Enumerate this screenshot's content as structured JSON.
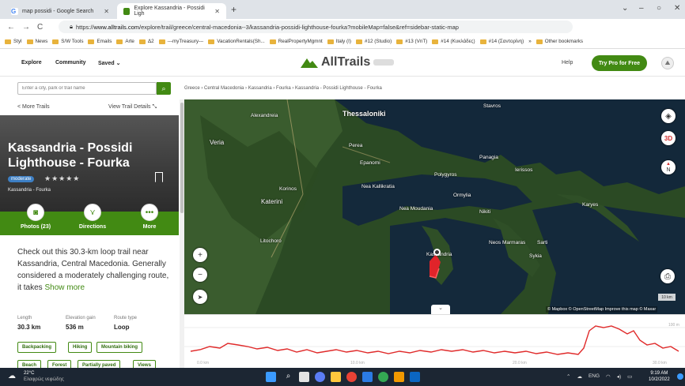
{
  "browser": {
    "tabs": [
      {
        "label": "map possidi - Google Search",
        "favicon_color": "#4285f4"
      },
      {
        "label": "Explore Kassandria - Possidi Ligh",
        "favicon_color": "#428a13"
      }
    ],
    "url_host": "www.alltrails.com",
    "url_path": "/explore/trail/greece/central-macedonia--3/kassandria-possidi-lighthouse-fourka?mobileMap=false&ref=sidebar-static-map",
    "url_prefix": "https://",
    "bookmarks": [
      "Styl",
      "News",
      "S/W Tools",
      "Emails",
      "Arte",
      "Δ2",
      "---myTreasury---",
      "VacationRentals(Sh...",
      "RealPropertyMgmnt",
      "Italy (I)",
      "#12 (Studio)",
      "#13 (VnT)",
      "#14 (Κυκλάδες)",
      "#14 (Σαντορίνη)",
      "»",
      "Other bookmarks"
    ]
  },
  "nav": {
    "explore": "Explore",
    "community": "Community",
    "saved": "Saved ⌄",
    "logo": "AllTrails",
    "help": "Help",
    "try_pro": "Try Pro for Free"
  },
  "search": {
    "placeholder": "Enter a city, park or trail name"
  },
  "breadcrumb": "Greece › Central Macedonia › Kassandria › Fourka › Kassandria - Possidi Lighthouse - Fourka",
  "sidebar": {
    "more_trails": "< More Trails",
    "view_details": "View Trail Details",
    "title": "Kassandria - Possidi Lighthouse - Fourka",
    "difficulty": "moderate",
    "stars": "★★★★★",
    "location": "Kassandria - Fourka",
    "actions": [
      {
        "label": "Photos (23)",
        "icon": "camera-icon",
        "glyph": "◙"
      },
      {
        "label": "Directions",
        "icon": "directions-icon",
        "glyph": "⋎"
      },
      {
        "label": "More",
        "icon": "more-icon",
        "glyph": "•••"
      }
    ],
    "description": "Check out this 30.3-km loop trail near Kassandria, Central Macedonia. Generally considered a moderately challenging route, it takes",
    "show_more": "Show more",
    "stats": [
      {
        "label": "Length",
        "value": "30.3 km"
      },
      {
        "label": "Elevation gain",
        "value": "536 m"
      },
      {
        "label": "Route type",
        "value": "Loop"
      }
    ],
    "tags": [
      "Backpacking",
      "Hiking",
      "Mountain biking",
      "Beach",
      "Forest",
      "Partially paved",
      "Views"
    ]
  },
  "map": {
    "labels": [
      {
        "text": "Thessaloniki",
        "big": true
      },
      {
        "text": "Veria"
      },
      {
        "text": "Alexandreia"
      },
      {
        "text": "Perea"
      },
      {
        "text": "Epanomi"
      },
      {
        "text": "Nea Kallikratia"
      },
      {
        "text": "Polygyros"
      },
      {
        "text": "Ormylia"
      },
      {
        "text": "Nea Moudania"
      },
      {
        "text": "Nikiti"
      },
      {
        "text": "Panagia"
      },
      {
        "text": "Ierissos"
      },
      {
        "text": "Karyes"
      },
      {
        "text": "Korinos"
      },
      {
        "text": "Katerini"
      },
      {
        "text": "Litochoro"
      },
      {
        "text": "Neos Marmaras"
      },
      {
        "text": "Sarti"
      },
      {
        "text": "Sykia"
      },
      {
        "text": "Kassandria"
      },
      {
        "text": "Stavros"
      }
    ],
    "btn_3d": "3D",
    "compass": "N",
    "scale": "10 km",
    "attribution": "© Mapbox © OpenStreetMap  Improve this map © Maxar"
  },
  "elevation": {
    "ticks": [
      "0.0 km",
      "10.0 km",
      "20.0 km",
      "30.0 km"
    ],
    "y_label": "100 m"
  },
  "taskbar": {
    "temp": "22°C",
    "weather": "Ελαφρώς νεφώδης",
    "lang": "ENG",
    "time": "9:19 AM",
    "date": "10/2/2022"
  }
}
